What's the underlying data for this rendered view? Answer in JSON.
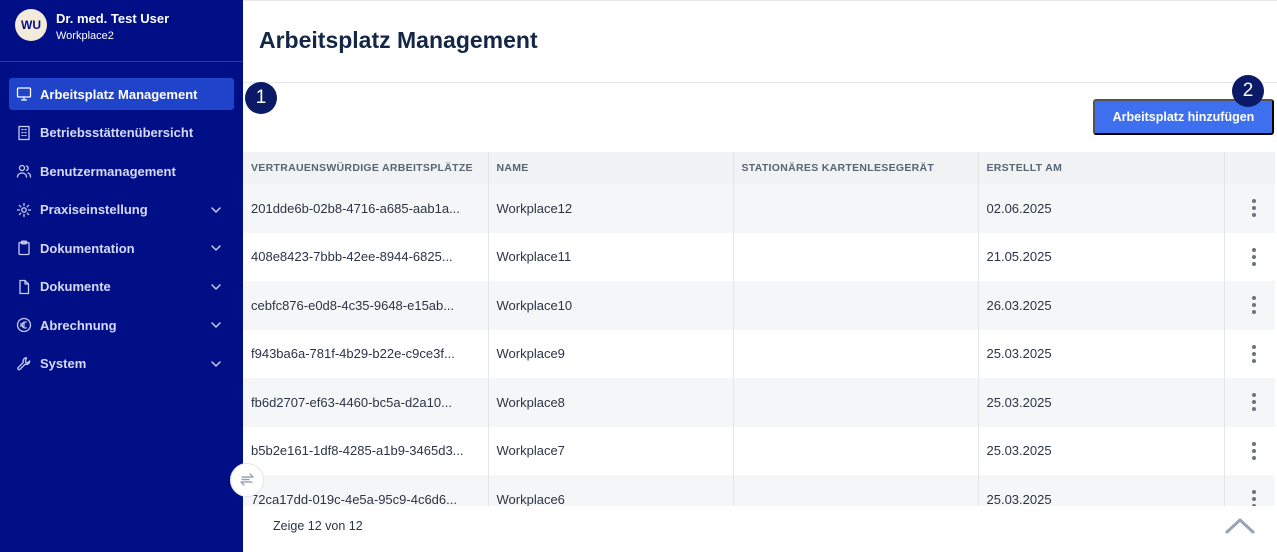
{
  "user": {
    "initials": "WU",
    "name": "Dr. med. Test User",
    "workplace": "Workplace2"
  },
  "sidebar": {
    "items": [
      {
        "label": "Arbeitsplatz Management",
        "icon": "monitor-icon",
        "active": true,
        "expandable": false
      },
      {
        "label": "Betriebsstättenübersicht",
        "icon": "building-icon",
        "active": false,
        "expandable": false
      },
      {
        "label": "Benutzermanagement",
        "icon": "users-icon",
        "active": false,
        "expandable": false
      },
      {
        "label": "Praxiseinstellung",
        "icon": "gear-icon",
        "active": false,
        "expandable": true
      },
      {
        "label": "Dokumentation",
        "icon": "clipboard-icon",
        "active": false,
        "expandable": true
      },
      {
        "label": "Dokumente",
        "icon": "file-icon",
        "active": false,
        "expandable": true
      },
      {
        "label": "Abrechnung",
        "icon": "euro-icon",
        "active": false,
        "expandable": true
      },
      {
        "label": "System",
        "icon": "wrench-icon",
        "active": false,
        "expandable": true
      }
    ]
  },
  "header": {
    "title": "Arbeitsplatz Management"
  },
  "badges": {
    "one": "1",
    "two": "2"
  },
  "toolbar": {
    "add_label": "Arbeitsplatz hinzufügen"
  },
  "table": {
    "columns": [
      "VERTRAUENSWÜRDIGE ARBEITSPLÄTZE",
      "NAME",
      "STATIONÄRES KARTENLESEGERÄT",
      "ERSTELLT AM",
      ""
    ],
    "rows": [
      {
        "id": "201dde6b-02b8-4716-a685-aab1a...",
        "name": "Workplace12",
        "reader": "",
        "created": "02.06.2025"
      },
      {
        "id": "408e8423-7bbb-42ee-8944-6825...",
        "name": "Workplace11",
        "reader": "",
        "created": "21.05.2025"
      },
      {
        "id": "cebfc876-e0d8-4c35-9648-e15ab...",
        "name": "Workplace10",
        "reader": "",
        "created": "26.03.2025"
      },
      {
        "id": "f943ba6a-781f-4b29-b22e-c9ce3f...",
        "name": "Workplace9",
        "reader": "",
        "created": "25.03.2025"
      },
      {
        "id": "fb6d2707-ef63-4460-bc5a-d2a10...",
        "name": "Workplace8",
        "reader": "",
        "created": "25.03.2025"
      },
      {
        "id": "b5b2e161-1df8-4285-a1b9-3465d3...",
        "name": "Workplace7",
        "reader": "",
        "created": "25.03.2025"
      },
      {
        "id": "72ca17dd-019c-4e5a-95c9-4c6d6...",
        "name": "Workplace6",
        "reader": "",
        "created": "25.03.2025"
      }
    ]
  },
  "footer": {
    "count_text": "Zeige 12 von 12"
  },
  "colors": {
    "sidebar_bg": "#000f85",
    "active_item": "#1f43c9",
    "primary_button": "#3d6fee",
    "title": "#152747"
  }
}
